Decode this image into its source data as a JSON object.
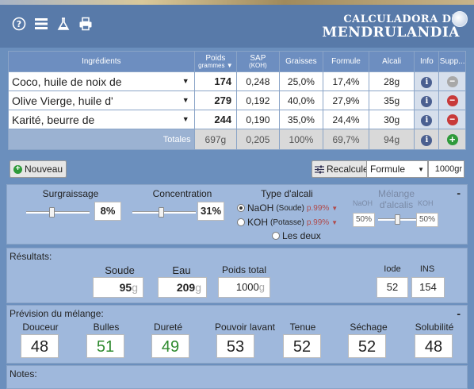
{
  "header": {
    "logo_line1": "CALCULADORA DE",
    "logo_line2": "MENDRULANDIA",
    "icons": [
      "help-icon",
      "menu-icon",
      "flask-icon",
      "print-icon"
    ]
  },
  "table": {
    "columns": {
      "ingredients": "Ingrédients",
      "weight": "Poids",
      "weight_sub": "grammes ▼",
      "sap": "SAP",
      "sap_sub": "(KOH)",
      "fats": "Graisses",
      "formula": "Formule",
      "alkali": "Alcali",
      "info": "Info",
      "delete": "Supp..."
    },
    "rows": [
      {
        "name": "Coco, huile de noix de",
        "weight": "174",
        "sap": "0,248",
        "fats": "25,0%",
        "formula": "17,4%",
        "alkali": "28g"
      },
      {
        "name": "Olive Vierge, huile d'",
        "weight": "279",
        "sap": "0,192",
        "fats": "40,0%",
        "formula": "27,9%",
        "alkali": "35g"
      },
      {
        "name": "Karité, beurre de",
        "weight": "244",
        "sap": "0,190",
        "fats": "35,0%",
        "formula": "24,4%",
        "alkali": "30g"
      }
    ],
    "totals": {
      "label": "Totales",
      "weight": "697g",
      "sap": "0,205",
      "fats": "100%",
      "formula": "69,7%",
      "alkali": "94g"
    }
  },
  "toolbar": {
    "new_label": "Nouveau",
    "recalc_label": "Recalculer",
    "formula_select": "Formule",
    "total_grams": "1000gr"
  },
  "options": {
    "superfat_label": "Surgraissage",
    "superfat_value": "8%",
    "superfat_level": 0.4,
    "concentration_label": "Concentration",
    "concentration_value": "31%",
    "concentration_level": 0.45,
    "alkali_type_label": "Type d'alcali",
    "naoh_label": "NaOH",
    "naoh_sub": "(Soude)",
    "naoh_purity": "p.99%",
    "koh_label": "KOH",
    "koh_sub": "(Potasse)",
    "koh_purity": "p.99%",
    "both_label": "Les deux",
    "mix_label": "Mélange d'alcalis",
    "mix_naoh": "NaOH",
    "mix_koh": "KOH",
    "mix_naoh_value": "50%",
    "mix_koh_value": "50%",
    "collapse": "-"
  },
  "results": {
    "title": "Résultats:",
    "soda_label": "Soude",
    "soda_value": "95",
    "water_label": "Eau",
    "water_value": "209",
    "unit": "g",
    "total_label": "Poids total",
    "total_value": "1000",
    "iodine_label": "Iode",
    "iodine_value": "52",
    "ins_label": "INS",
    "ins_value": "154"
  },
  "prevision": {
    "title": "Prévision du mélange:",
    "collapse": "-",
    "items": [
      {
        "label": "Douceur",
        "value": "48",
        "color": "#222222"
      },
      {
        "label": "Bulles",
        "value": "51",
        "color": "#2e8a2e"
      },
      {
        "label": "Dureté",
        "value": "49",
        "color": "#2e8a2e"
      },
      {
        "label": "Pouvoir lavant",
        "value": "53",
        "color": "#222222"
      },
      {
        "label": "Tenue",
        "value": "52",
        "color": "#222222"
      },
      {
        "label": "Séchage",
        "value": "52",
        "color": "#222222"
      },
      {
        "label": "Solubilité",
        "value": "48",
        "color": "#222222"
      }
    ]
  },
  "notes": {
    "title": "Notes:"
  }
}
